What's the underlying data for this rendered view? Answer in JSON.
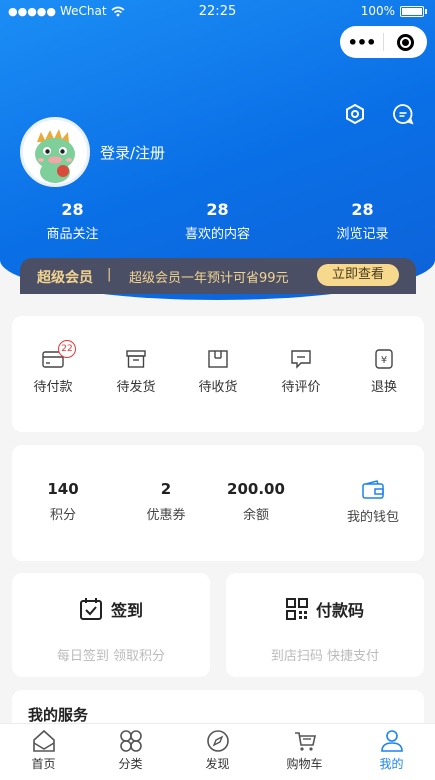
{
  "status_bar": {
    "carrier": "WeChat",
    "time": "22:25",
    "battery": "100%"
  },
  "capsule": {
    "more_icon": "more-dots-icon",
    "close_icon": "target-close-icon"
  },
  "header": {
    "login_text": "登录/注册",
    "icons": [
      "settings-icon",
      "message-icon"
    ]
  },
  "stats": [
    {
      "num": "28",
      "label": "商品关注"
    },
    {
      "num": "28",
      "label": "喜欢的内容"
    },
    {
      "num": "28",
      "label": "浏览记录"
    }
  ],
  "vip": {
    "title": "超级会员",
    "divider": "|",
    "desc": "超级会员一年预计可省99元",
    "button": "立即查看",
    "colors": {
      "bg": "#4a4f66",
      "text": "#f3d48f",
      "button": "#f7d98e"
    }
  },
  "orders": [
    {
      "label": "待付款",
      "icon": "wallet-card-icon",
      "badge": "22"
    },
    {
      "label": "待发货",
      "icon": "box-icon"
    },
    {
      "label": "待收货",
      "icon": "package-icon"
    },
    {
      "label": "待评价",
      "icon": "comment-icon"
    },
    {
      "label": "退换",
      "icon": "refund-icon"
    }
  ],
  "assets": [
    {
      "num": "140",
      "label": "积分"
    },
    {
      "num": "2",
      "label": "优惠券"
    },
    {
      "num": "200.00",
      "label": "余额"
    },
    {
      "label": "我的钱包",
      "icon": "wallet-icon"
    }
  ],
  "quick": [
    {
      "title": "签到",
      "sub": "每日签到 领取积分",
      "icon": "calendar-check-icon"
    },
    {
      "title": "付款码",
      "sub": "到店扫码 快捷支付",
      "icon": "qrcode-icon"
    }
  ],
  "services": {
    "title": "我的服务"
  },
  "tabbar": {
    "active_color": "#1a84f0",
    "items": [
      {
        "label": "首页",
        "icon": "home-icon"
      },
      {
        "label": "分类",
        "icon": "category-icon"
      },
      {
        "label": "发现",
        "icon": "compass-icon"
      },
      {
        "label": "购物车",
        "icon": "cart-icon"
      },
      {
        "label": "我的",
        "icon": "user-icon",
        "active": true
      }
    ]
  }
}
